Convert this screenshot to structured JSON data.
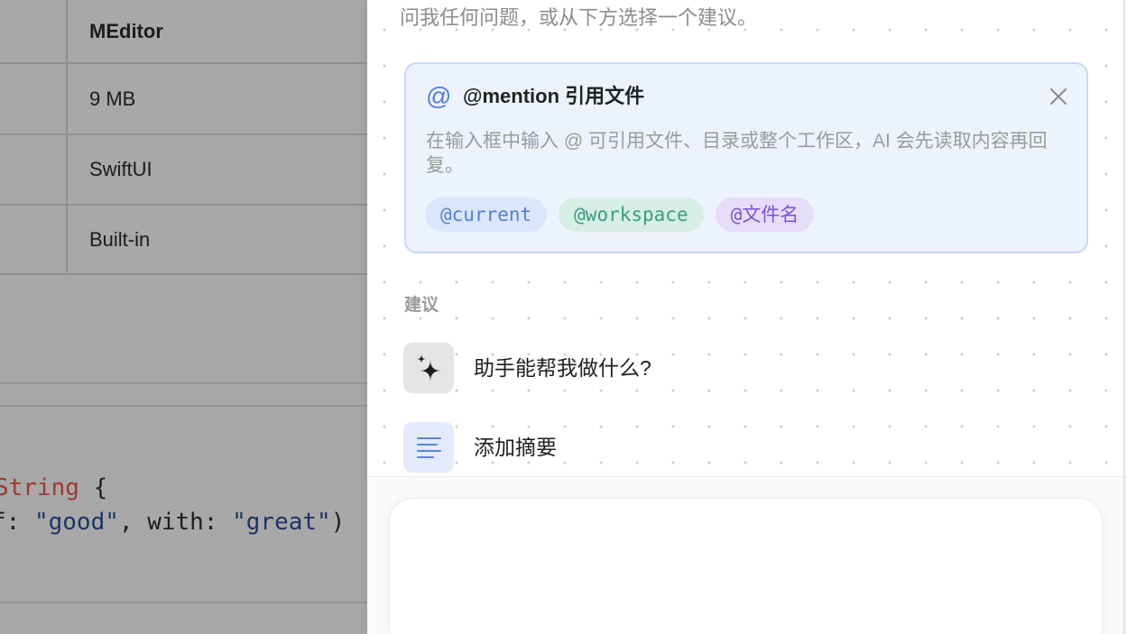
{
  "background_editor": {
    "table_rows": [
      "MEditor",
      "9 MB",
      "SwiftUI",
      "Built-in"
    ],
    "code_lines": [
      [
        {
          "text": "String",
          "color": "#9a3a33"
        },
        {
          "text": " {",
          "color": "#1e1e1e"
        }
      ],
      [
        {
          "text": "f: ",
          "color": "#1e1e1e"
        },
        {
          "text": "\"good\"",
          "color": "#1b3564"
        },
        {
          "text": ", with: ",
          "color": "#1e1e1e"
        },
        {
          "text": "\"great\"",
          "color": "#1b3564"
        },
        {
          "text": ")",
          "color": "#1e1e1e"
        }
      ]
    ]
  },
  "assistant_panel": {
    "intro_text": "问我任何问题，或从下方选择一个建议。",
    "mention_card": {
      "icon": "at-icon",
      "icon_glyph": "@",
      "title": "@mention 引用文件",
      "close_icon": "close-icon",
      "description": "在输入框中输入 @ 可引用文件、目录或整个工作区，AI 会先读取内容再回复。",
      "chips": [
        {
          "label": "@current",
          "text_color": "#4f7fdb",
          "bg_color": "#dce6fa"
        },
        {
          "label": "@workspace",
          "text_color": "#3b9e77",
          "bg_color": "#d6eee5"
        },
        {
          "label": "@文件名",
          "text_color": "#7b52d8",
          "bg_color": "#e6ddf8"
        }
      ]
    },
    "suggestions_label": "建议",
    "suggestions": [
      {
        "icon": "sparkles-icon",
        "label": "助手能帮我做什么?"
      },
      {
        "icon": "text-lines-icon",
        "label": "添加摘要"
      }
    ],
    "input": {
      "value": ""
    }
  },
  "colors": {
    "accent": "#4f7fdb",
    "overlay": "#a8a8a8",
    "panel_background": "#ffffff",
    "card_background": "#ecf2fd",
    "card_border": "#cad7f4"
  }
}
